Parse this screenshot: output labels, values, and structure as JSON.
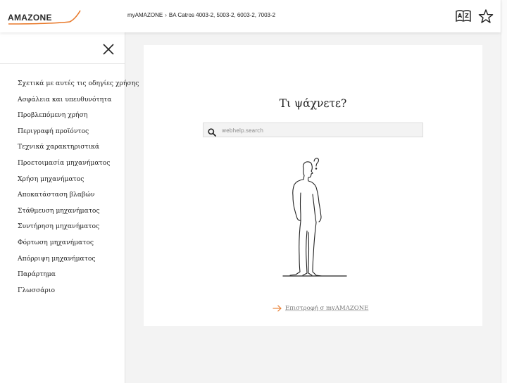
{
  "header": {
    "logo_text": "AMAZONE",
    "breadcrumb": {
      "root": "myAMAZONE",
      "separator": "›",
      "current": "BA Catros 4003-2, 5003-2, 6003-2, 7003-2"
    },
    "icons": [
      "dictionary-icon",
      "star-icon"
    ]
  },
  "sidebar": {
    "close_icon": "close-icon",
    "items": [
      {
        "label": "Σχετικά με αυτές τις οδηγίες χρήσης"
      },
      {
        "label": "Ασφάλεια και υπευθυνότητα"
      },
      {
        "label": "Προβλεπόμενη χρήση"
      },
      {
        "label": "Περιγραφή προϊόντος"
      },
      {
        "label": "Τεχνικά χαρακτηριστικά"
      },
      {
        "label": "Προετοιμασία μηχανήματος"
      },
      {
        "label": "Χρήση μηχανήματος"
      },
      {
        "label": "Αποκατάσταση βλαβών"
      },
      {
        "label": "Στάθμευση μηχανήματος"
      },
      {
        "label": "Συντήρηση μηχανήματος"
      },
      {
        "label": "Φόρτωση μηχανήματος"
      },
      {
        "label": "Απόρριψη μηχανήματος"
      },
      {
        "label": "Παράρτημα"
      },
      {
        "label": "Γλωσσάριο"
      }
    ]
  },
  "main": {
    "title": "Τι ψάχνετε?",
    "search": {
      "placeholder": "webhelp.search",
      "value": ""
    },
    "back_link": "Επιστροφή σ myAMAZONE"
  },
  "colors": {
    "accent": "#e8792a",
    "text": "#222222",
    "background": "#f3f3f3"
  }
}
